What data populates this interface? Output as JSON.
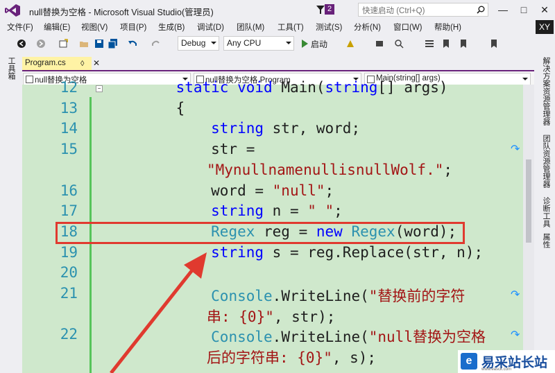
{
  "window": {
    "title": "null替换为空格 - Microsoft Visual Studio(管理员)",
    "notification_count": "2",
    "quick_launch_placeholder": "快速启动 (Ctrl+Q)",
    "user_initials": "XY"
  },
  "menu": [
    "文件(F)",
    "编辑(E)",
    "视图(V)",
    "项目(P)",
    "生成(B)",
    "调试(D)",
    "团队(M)",
    "工具(T)",
    "测试(S)",
    "分析(N)",
    "窗口(W)",
    "帮助(H)"
  ],
  "toolbar": {
    "configuration": "Debug",
    "platform": "Any CPU",
    "start_label": "启动"
  },
  "left_panel": {
    "toolbox_label": "工具箱"
  },
  "right_panel": {
    "tabs": [
      "解决方案资源管理器",
      "团队资源管理器",
      "诊断工具",
      "属性"
    ]
  },
  "tab": {
    "file_name": "Program.cs"
  },
  "navbar": {
    "project": "null替换为空格",
    "class": "null替换为空格.Program",
    "member": "Main(string[] args)"
  },
  "code_lines": [
    {
      "n": "12",
      "segments": [
        [
          "    ",
          ""
        ],
        [
          "static",
          "kw"
        ],
        [
          " ",
          ""
        ],
        [
          "void",
          "kw"
        ],
        [
          " Main(",
          ""
        ],
        [
          "string",
          "kw"
        ],
        [
          "[] args)",
          ""
        ]
      ]
    },
    {
      "n": "13",
      "segments": [
        [
          "    {",
          ""
        ]
      ]
    },
    {
      "n": "14",
      "segments": [
        [
          "        ",
          ""
        ],
        [
          "string",
          "kw"
        ],
        [
          " str, word;",
          ""
        ]
      ]
    },
    {
      "n": "15",
      "segments": [
        [
          "        str =",
          ""
        ]
      ]
    },
    {
      "n": "",
      "segments": [
        [
          "\"MynullnamenullisnullWolf.\"",
          "st"
        ],
        [
          ";",
          ""
        ]
      ]
    },
    {
      "n": "16",
      "segments": [
        [
          "        word = ",
          ""
        ],
        [
          "\"null\"",
          "st"
        ],
        [
          ";",
          ""
        ]
      ]
    },
    {
      "n": "17",
      "segments": [
        [
          "        ",
          ""
        ],
        [
          "string",
          "kw"
        ],
        [
          " n = ",
          ""
        ],
        [
          "\" \"",
          "st"
        ],
        [
          ";",
          ""
        ]
      ]
    },
    {
      "n": "18",
      "segments": [
        [
          "        ",
          ""
        ],
        [
          "Regex",
          "ty"
        ],
        [
          " reg = ",
          ""
        ],
        [
          "new",
          "kw"
        ],
        [
          " ",
          ""
        ],
        [
          "Regex",
          "ty"
        ],
        [
          "(word);",
          ""
        ]
      ]
    },
    {
      "n": "19",
      "segments": [
        [
          "        ",
          ""
        ],
        [
          "string",
          "kw"
        ],
        [
          " s = reg.Replace(str, n);",
          ""
        ]
      ]
    },
    {
      "n": "20",
      "segments": [
        [
          "",
          ""
        ]
      ]
    },
    {
      "n": "21",
      "segments": [
        [
          "        ",
          ""
        ],
        [
          "Console",
          "ty"
        ],
        [
          ".WriteLine(",
          ""
        ],
        [
          "\"替换前的字符",
          "st"
        ]
      ]
    },
    {
      "n": "",
      "segments": [
        [
          "串: {0}\"",
          "st"
        ],
        [
          ", str);",
          ""
        ]
      ]
    },
    {
      "n": "22",
      "segments": [
        [
          "        ",
          ""
        ],
        [
          "Console",
          "ty"
        ],
        [
          ".WriteLine(",
          ""
        ],
        [
          "\"null替换为空格",
          "st"
        ]
      ]
    },
    {
      "n": "",
      "segments": [
        [
          "后的字符串: {0}\"",
          "st"
        ],
        [
          ", s);",
          ""
        ]
      ]
    }
  ],
  "watermark": {
    "text": "易采站长站",
    "url": "www.easck.com"
  }
}
